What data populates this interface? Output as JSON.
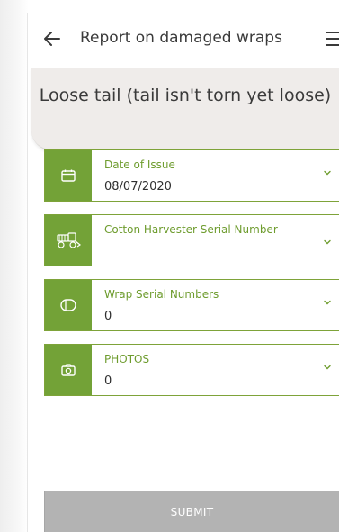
{
  "header": {
    "title": "Report on damaged wraps",
    "back_icon": "arrow-left-icon",
    "menu_icon": "hamburger-menu-icon"
  },
  "banner": {
    "text": "Loose tail (tail isn't torn yet loose)"
  },
  "fields": [
    {
      "label": "Date of Issue",
      "value": "08/07/2020",
      "icon": "calendar-icon"
    },
    {
      "label": "Cotton Harvester Serial Number",
      "value": "",
      "icon": "harvester-icon"
    },
    {
      "label": "Wrap Serial Numbers",
      "value": "0",
      "icon": "wrap-icon"
    },
    {
      "label": "PHOTOS",
      "value": "0",
      "icon": "camera-icon"
    }
  ],
  "submit": {
    "label": "SUBMIT"
  },
  "colors": {
    "accent": "#73a237",
    "label": "#6e9c2e",
    "submit_bg": "#b3b3b3",
    "banner_bg": "#efecea"
  }
}
